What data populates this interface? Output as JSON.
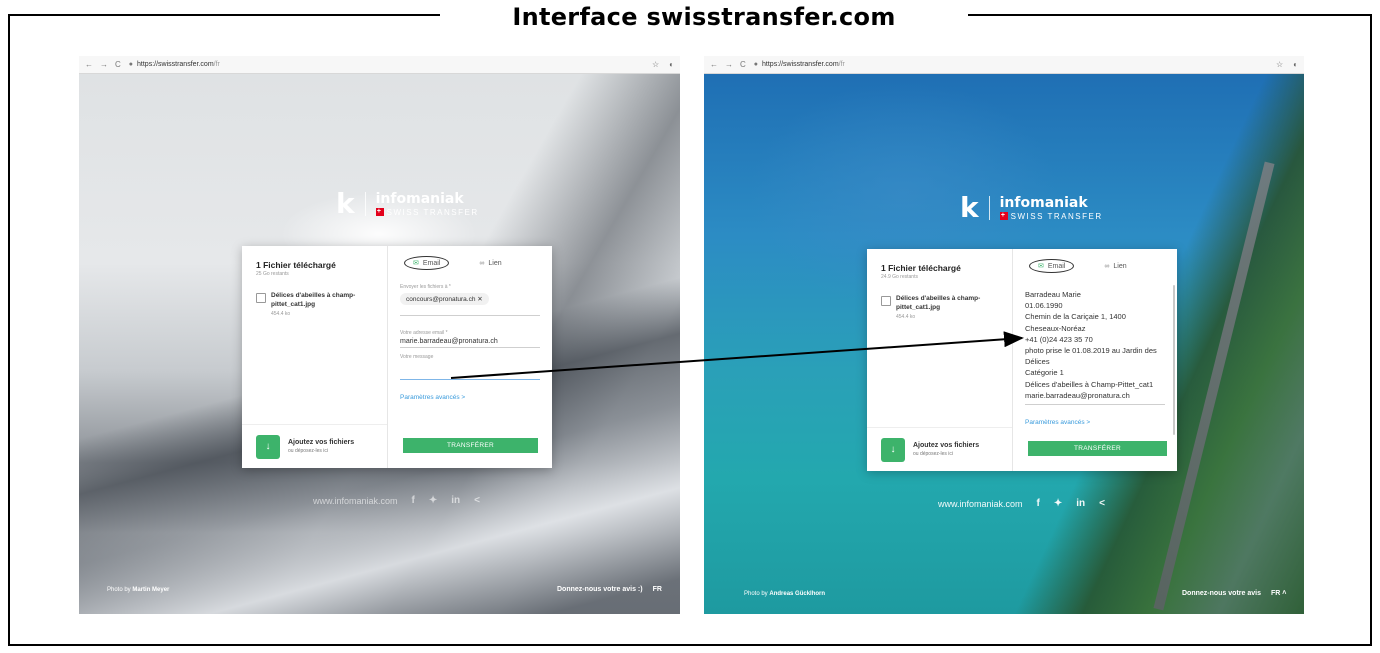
{
  "figure_title": "Interface swisstransfer.com",
  "browser": {
    "url_host": "https://swisstransfer.com",
    "url_path": "/fr"
  },
  "logo": {
    "k": "k",
    "brand": "infomaniak",
    "sub": "SWISS TRANSFER",
    "flag": "+"
  },
  "left_panel": {
    "files_title": "1 Fichier téléchargé",
    "files_sub": "25 Go restants",
    "file_name": "Délices d'abeilles à champ-pittet_cat1.jpg",
    "file_size": "454.4 ko",
    "add_title": "Ajoutez vos fichiers",
    "add_sub": "ou déposez-les ici",
    "tab_email": "Email",
    "tab_link": "Lien",
    "send_to_label": "Envoyer les fichiers à *",
    "recipient_chip": "concours@pronatura.ch ✕",
    "your_email_label": "Votre adresse email *",
    "your_email_value": "marie.barradeau@pronatura.ch",
    "message_label": "Votre message",
    "advanced": "Paramètres avancés  >",
    "transfer_button": "TRANSFÉRER",
    "social_site": "www.infomaniak.com",
    "photo_credit_prefix": "Photo by",
    "photo_credit_name": "Martin Meyer",
    "feedback": "Donnez-nous votre avis :)",
    "lang": "FR"
  },
  "right_panel": {
    "files_title": "1 Fichier téléchargé",
    "files_sub": "24.9 Go restants",
    "file_name": "Délices d'abeilles à champ-pittet_cat1.jpg",
    "file_size": "454.4 ko",
    "add_title": "Ajoutez vos fichiers",
    "add_sub": "ou déposez-les ici",
    "tab_email": "Email",
    "tab_link": "Lien",
    "message_lines": [
      "Barradeau Marie",
      "01.06.1990",
      "Chemin de la Cariçaie 1, 1400",
      "Cheseaux-Noréaz",
      "+41 (0)24 423 35 70",
      "photo prise le 01.08.2019 au Jardin des",
      "Délices",
      "Catégorie 1",
      "Délices d'abeilles à Champ-Pittet_cat1",
      "marie.barradeau@pronatura.ch"
    ],
    "advanced": "Paramètres avancés  >",
    "transfer_button": "TRANSFÉRER",
    "social_site": "www.infomaniak.com",
    "photo_credit_prefix": "Photo by",
    "photo_credit_name": "Andreas Gücklhorn",
    "feedback": "Donnez-nous votre avis",
    "lang": "FR  ˄"
  },
  "icons": {
    "back": "←",
    "forward": "→",
    "reload": "C",
    "lock": "🔒",
    "star": "☆",
    "profile": "◐",
    "mail": "✉",
    "link": "🔗",
    "download": "↓",
    "facebook": "f",
    "twitter": "🐦",
    "linkedin": "in",
    "share": "<"
  },
  "colors": {
    "accent_green": "#3db36b",
    "link_blue": "#3a9bdc",
    "swiss_red": "#e3001b"
  }
}
